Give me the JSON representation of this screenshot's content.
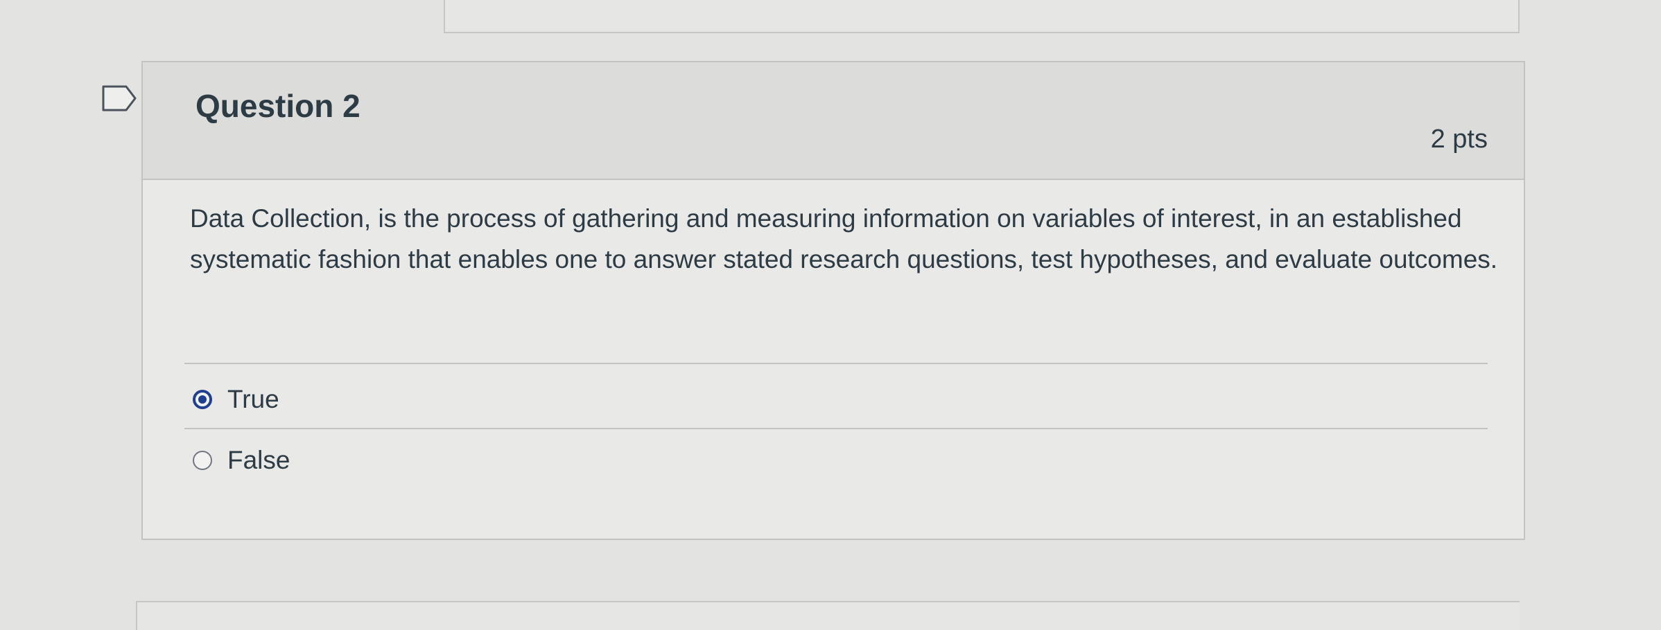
{
  "question": {
    "title": "Question 2",
    "points": "2 pts",
    "text": "Data Collection, is the process of gathering and measuring information on variables of interest, in an established systematic fashion that enables one to answer stated research questions, test hypotheses, and evaluate outcomes."
  },
  "answers": [
    {
      "label": "True",
      "selected": true
    },
    {
      "label": "False",
      "selected": false
    }
  ],
  "colors": {
    "radio_selected": "#1f3f8f",
    "text": "#2d3b45",
    "header_bg": "#dcdcda"
  },
  "icons": {
    "flag": "flag-question-icon"
  }
}
